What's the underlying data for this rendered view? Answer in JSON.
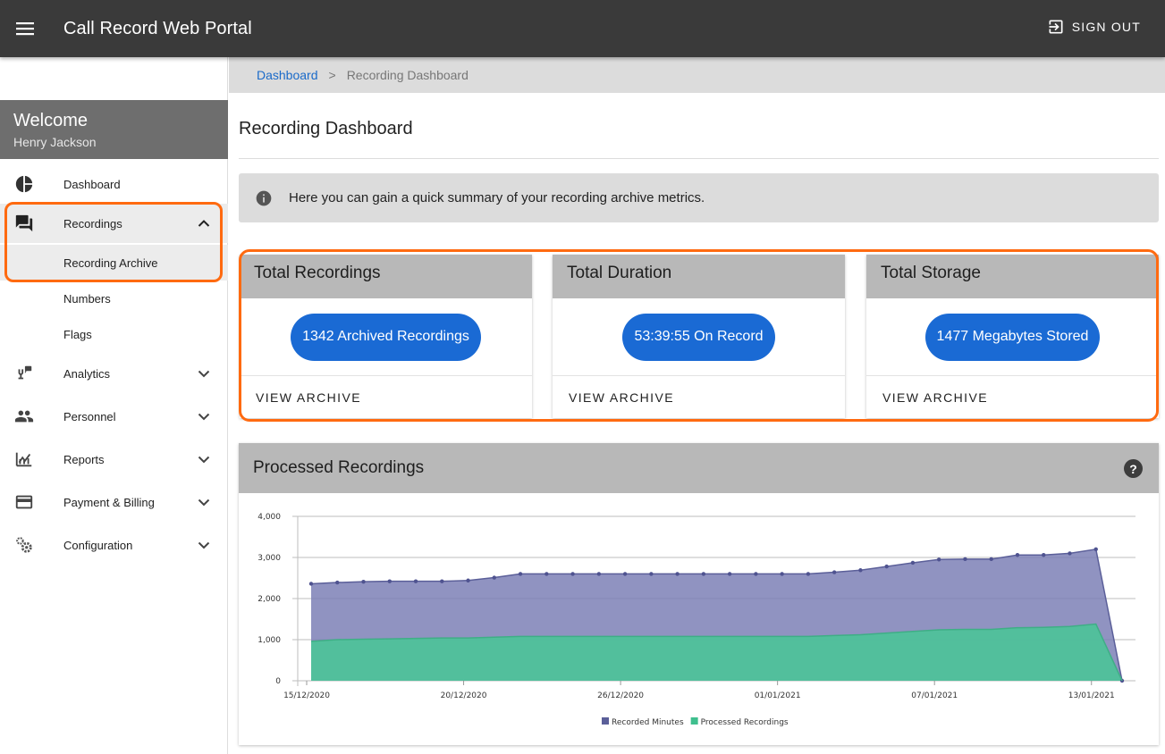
{
  "appbar": {
    "title": "Call Record Web Portal",
    "signout_label": "SIGN OUT"
  },
  "sidebar": {
    "welcome_title": "Welcome",
    "user_name": "Henry Jackson",
    "items": [
      {
        "label": "Dashboard",
        "icon": "pie-chart-icon"
      },
      {
        "label": "Recordings",
        "icon": "forum-icon",
        "expanded": true,
        "children": [
          {
            "label": "Recording Archive"
          },
          {
            "label": "Numbers"
          },
          {
            "label": "Flags"
          }
        ]
      },
      {
        "label": "Analytics",
        "icon": "analytics-icon"
      },
      {
        "label": "Personnel",
        "icon": "people-icon"
      },
      {
        "label": "Reports",
        "icon": "reports-icon"
      },
      {
        "label": "Payment & Billing",
        "icon": "credit-card-icon"
      },
      {
        "label": "Configuration",
        "icon": "settings-icon"
      }
    ]
  },
  "breadcrumb": {
    "root": "Dashboard",
    "separator": ">",
    "current": "Recording Dashboard"
  },
  "page": {
    "title": "Recording Dashboard",
    "info_text": "Here you can gain a quick summary of your recording archive metrics."
  },
  "cards": [
    {
      "title": "Total Recordings",
      "value": "1342 Archived Recordings",
      "action": "VIEW ARCHIVE"
    },
    {
      "title": "Total Duration",
      "value": "53:39:55 On Record",
      "action": "VIEW ARCHIVE"
    },
    {
      "title": "Total Storage",
      "value": "1477 Megabytes Stored",
      "action": "VIEW ARCHIVE"
    }
  ],
  "chart_card": {
    "title": "Processed Recordings",
    "help": "?"
  },
  "colors": {
    "appbar": "#3a3a3a",
    "accent": "#1a6ad4",
    "highlight": "#ff6a10",
    "series_minutes": "#7c80b6",
    "series_processed": "#4fc19a"
  },
  "chart_data": {
    "type": "area",
    "x_ticks": [
      "15/12/2020",
      "20/12/2020",
      "26/12/2020",
      "01/01/2021",
      "07/01/2021",
      "13/01/2021"
    ],
    "y_ticks": [
      "0",
      "1,000",
      "2,000",
      "3,000",
      "4,000"
    ],
    "ylim": [
      0,
      4000
    ],
    "legend_position": "bottom",
    "grid": true,
    "series": [
      {
        "name": "Recorded Minutes",
        "values": [
          2360,
          2390,
          2410,
          2420,
          2420,
          2420,
          2440,
          2510,
          2600,
          2600,
          2600,
          2600,
          2600,
          2600,
          2600,
          2600,
          2600,
          2600,
          2600,
          2600,
          2640,
          2690,
          2780,
          2870,
          2950,
          2960,
          2960,
          3060,
          3060,
          3100,
          3200,
          0
        ]
      },
      {
        "name": "Processed Recordings",
        "values": [
          960,
          1000,
          1010,
          1020,
          1030,
          1040,
          1040,
          1060,
          1080,
          1080,
          1080,
          1080,
          1080,
          1080,
          1080,
          1080,
          1080,
          1080,
          1080,
          1080,
          1100,
          1120,
          1160,
          1200,
          1240,
          1250,
          1250,
          1290,
          1300,
          1320,
          1380,
          0
        ]
      }
    ]
  }
}
